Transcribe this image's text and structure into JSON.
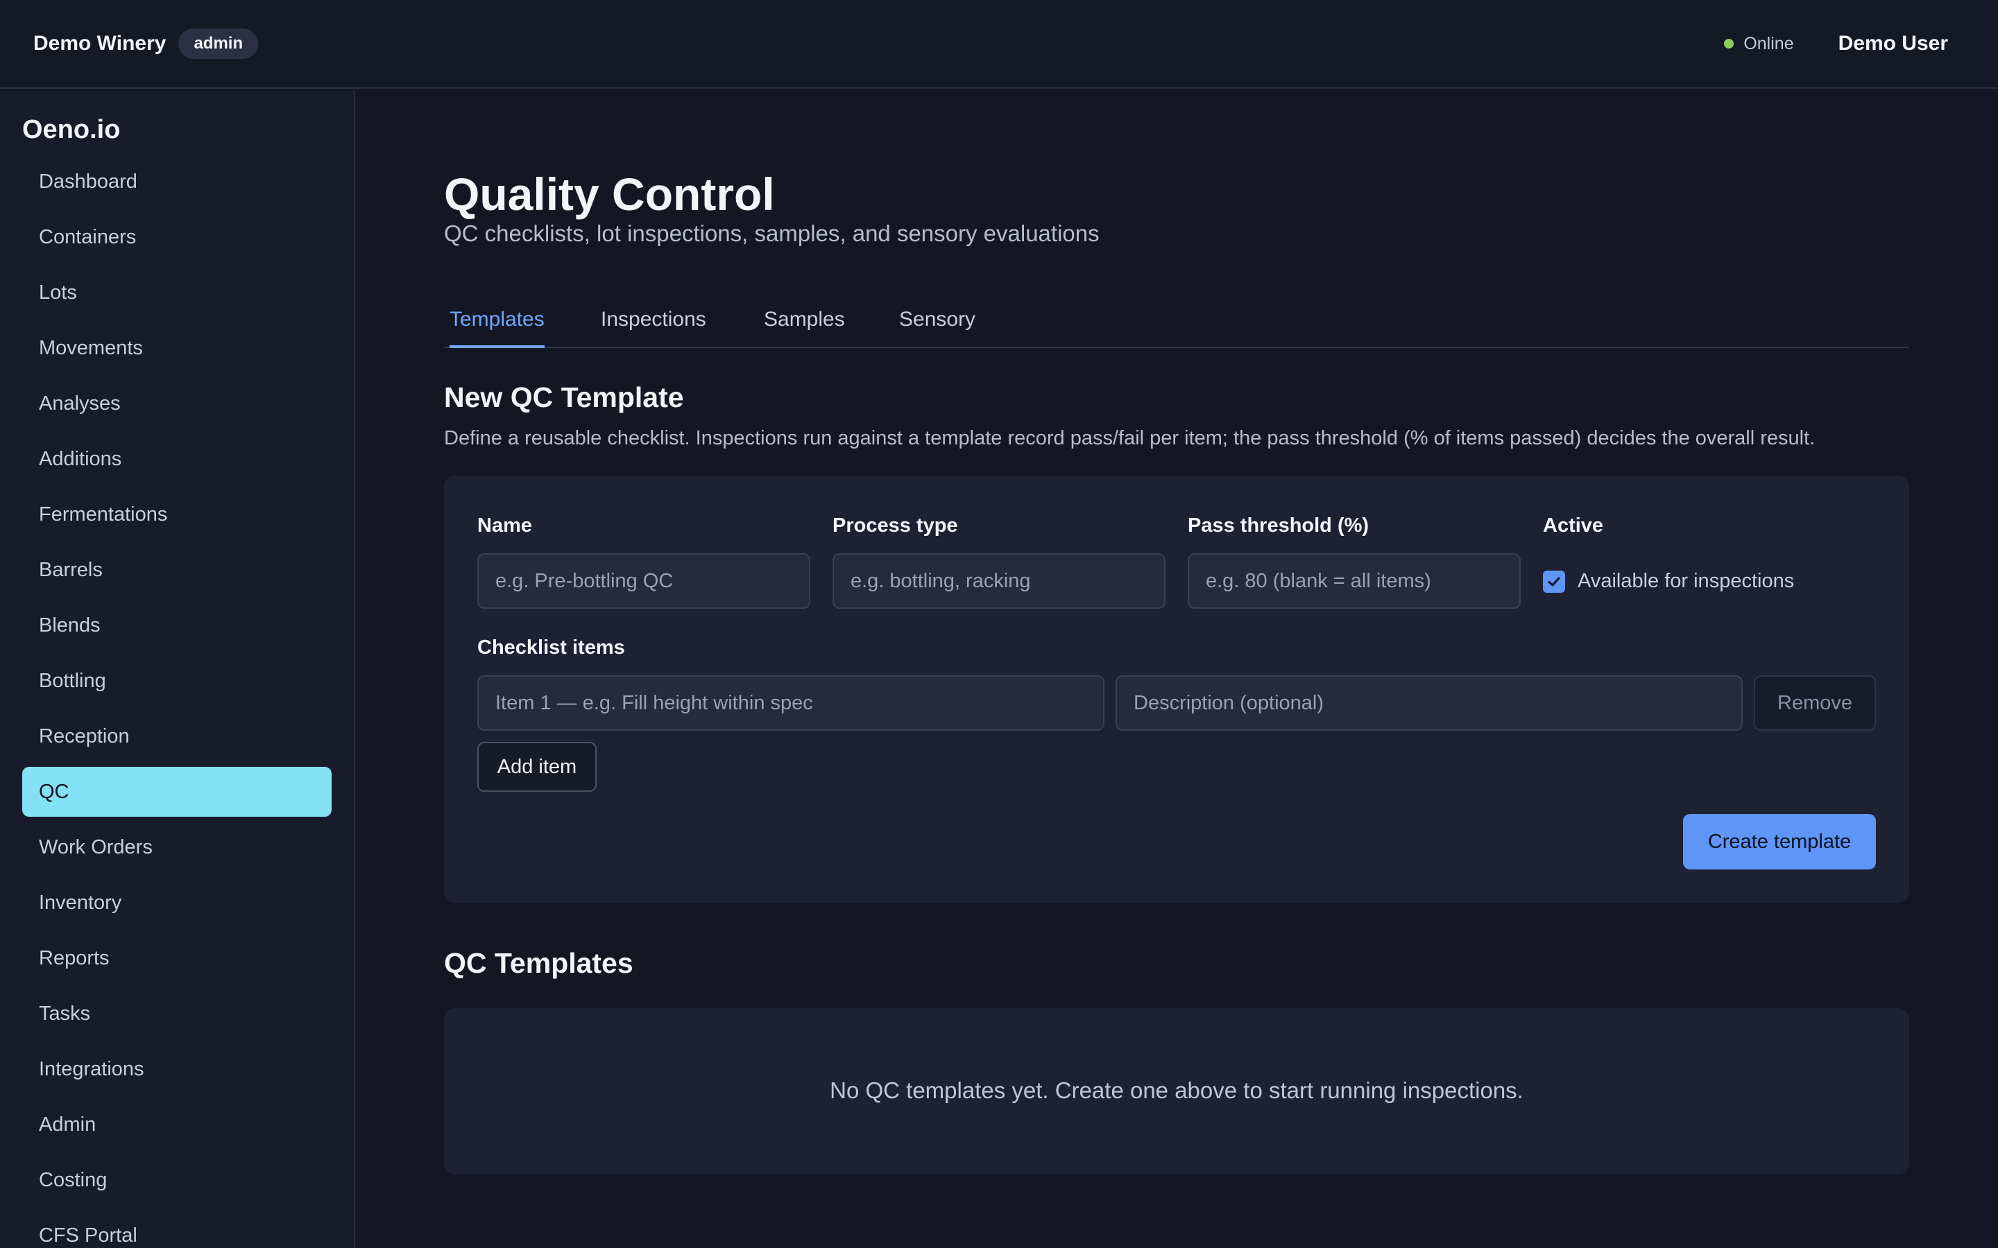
{
  "header": {
    "org_name": "Demo Winery",
    "role_badge": "admin",
    "status": "Online",
    "user_name": "Demo User"
  },
  "sidebar": {
    "brand": "Oeno.io",
    "items": [
      {
        "label": "Dashboard"
      },
      {
        "label": "Containers"
      },
      {
        "label": "Lots"
      },
      {
        "label": "Movements"
      },
      {
        "label": "Analyses"
      },
      {
        "label": "Additions"
      },
      {
        "label": "Fermentations"
      },
      {
        "label": "Barrels"
      },
      {
        "label": "Blends"
      },
      {
        "label": "Bottling"
      },
      {
        "label": "Reception"
      },
      {
        "label": "QC"
      },
      {
        "label": "Work Orders"
      },
      {
        "label": "Inventory"
      },
      {
        "label": "Reports"
      },
      {
        "label": "Tasks"
      },
      {
        "label": "Integrations"
      },
      {
        "label": "Admin"
      },
      {
        "label": "Costing"
      },
      {
        "label": "CFS Portal"
      }
    ],
    "active_item": "QC"
  },
  "page": {
    "title": "Quality Control",
    "subtitle": "QC checklists, lot inspections, samples, and sensory evaluations"
  },
  "tabs": [
    {
      "label": "Templates"
    },
    {
      "label": "Inspections"
    },
    {
      "label": "Samples"
    },
    {
      "label": "Sensory"
    }
  ],
  "active_tab": "Templates",
  "new_template": {
    "title": "New QC Template",
    "description": "Define a reusable checklist. Inspections run against a template record pass/fail per item; the pass threshold (% of items passed) decides the overall result.",
    "name_label": "Name",
    "name_placeholder": "e.g. Pre-bottling QC",
    "process_label": "Process type",
    "process_placeholder": "e.g. bottling, racking",
    "threshold_label": "Pass threshold (%)",
    "threshold_placeholder": "e.g. 80 (blank = all items)",
    "active_label": "Active",
    "active_checkbox_label": "Available for inspections",
    "active_checked": true,
    "checklist_label": "Checklist items",
    "item_placeholder": "Item 1 — e.g. Fill height within spec",
    "description_placeholder": "Description (optional)",
    "remove_label": "Remove",
    "add_item_label": "Add item",
    "create_label": "Create template"
  },
  "templates": {
    "title": "QC Templates",
    "empty_text": "No QC templates yet. Create one above to start running inspections."
  },
  "colors": {
    "accent": "#5e95f7",
    "tab_active": "#6ea8ff",
    "nav_active": "#84e1f5",
    "status_online": "#8ccf5c"
  }
}
